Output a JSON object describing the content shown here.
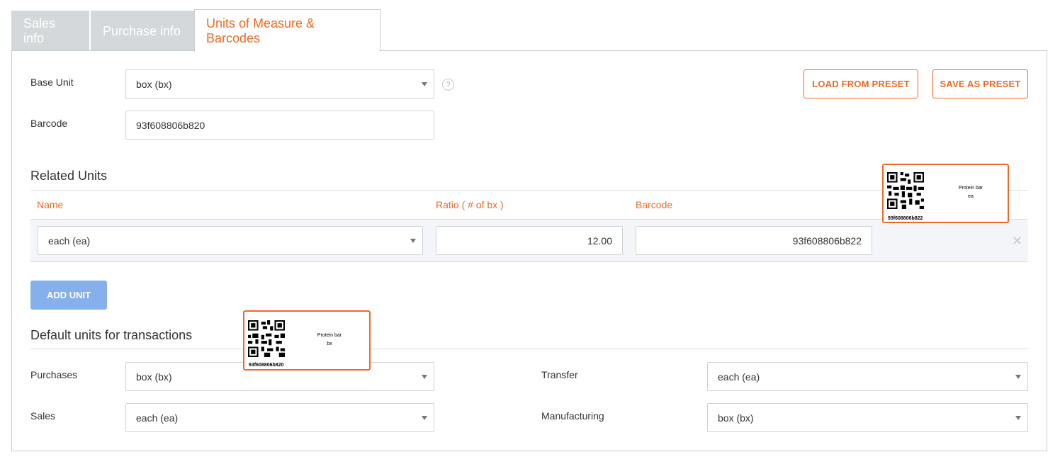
{
  "tabs": [
    {
      "label": "Sales info"
    },
    {
      "label": "Purchase info"
    },
    {
      "label": "Units of Measure & Barcodes"
    }
  ],
  "base_unit": {
    "label": "Base Unit",
    "value": "box (bx)",
    "help_icon": "question-circle-icon"
  },
  "barcode": {
    "label": "Barcode",
    "value": "93f608806b820"
  },
  "buttons": {
    "load_preset": "LOAD FROM PRESET",
    "save_preset": "SAVE AS PRESET",
    "add_unit": "ADD UNIT"
  },
  "related_units": {
    "title": "Related Units",
    "columns": {
      "name": "Name",
      "ratio": "Ratio ( # of bx )",
      "barcode": "Barcode"
    },
    "rows": [
      {
        "name": "each (ea)",
        "ratio": "12.00",
        "barcode": "93f608806b822",
        "remove_icon": "close-icon"
      }
    ]
  },
  "defaults": {
    "title": "Default units for transactions",
    "purchases": {
      "label": "Purchases",
      "value": "box (bx)"
    },
    "sales": {
      "label": "Sales",
      "value": "each (ea)"
    },
    "transfer": {
      "label": "Transfer",
      "value": "each (ea)"
    },
    "manufacturing": {
      "label": "Manufacturing",
      "value": "box (bx)"
    }
  },
  "label_previews": [
    {
      "product": "Protein bar",
      "unit": "ea",
      "code": "93f608806b822"
    },
    {
      "product": "Protein bar",
      "unit": "bx",
      "code": "93f608806b820"
    }
  ],
  "colors": {
    "accent": "#ee6a23",
    "add_button": "#86b0eb",
    "tab_inactive": "#d4d8da"
  }
}
